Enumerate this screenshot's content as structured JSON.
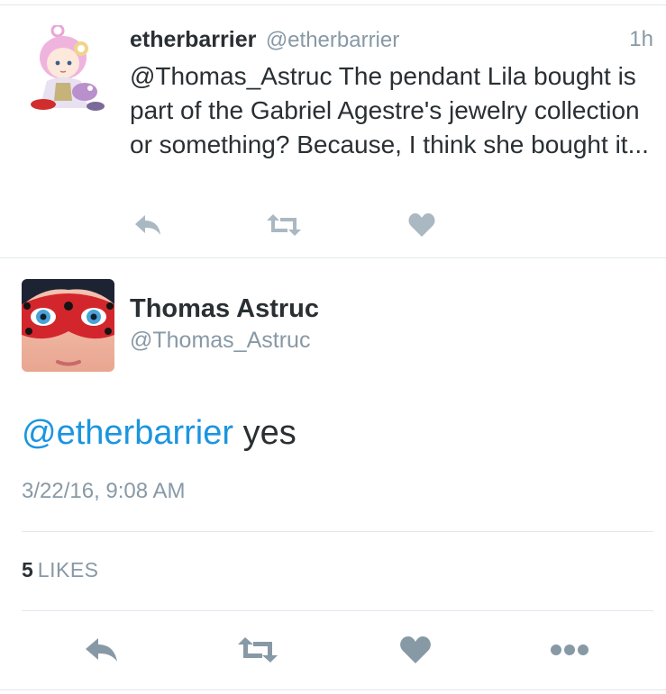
{
  "reply_tweet": {
    "display_name": "etherbarrier",
    "handle": "@etherbarrier",
    "time": "1h",
    "text": "@Thomas_Astruc The pendant Lila bought is part of the Gabriel Agestre's jewelry collection or something? Because, I think she bought it...",
    "actions": {
      "reply_icon": "reply-icon",
      "retweet_icon": "retweet-icon",
      "like_icon": "heart-icon"
    }
  },
  "main_tweet": {
    "display_name": "Thomas Astruc",
    "handle": "@Thomas_Astruc",
    "mention": "@etherbarrier",
    "text_rest": "yes",
    "date": "3/22/16, 9:08 AM",
    "likes_count": "5",
    "likes_label": "LIKES",
    "actions": {
      "reply_icon": "reply-icon",
      "retweet_icon": "retweet-icon",
      "like_icon": "heart-icon",
      "more_icon": "more-dots-icon"
    }
  },
  "colors": {
    "text_primary": "#292f33",
    "text_secondary": "#8899a6",
    "link": "#1b95e0",
    "icon_gray": "#aab8c2",
    "icon_dark": "#8899a6",
    "divider": "#e1e8ed"
  }
}
